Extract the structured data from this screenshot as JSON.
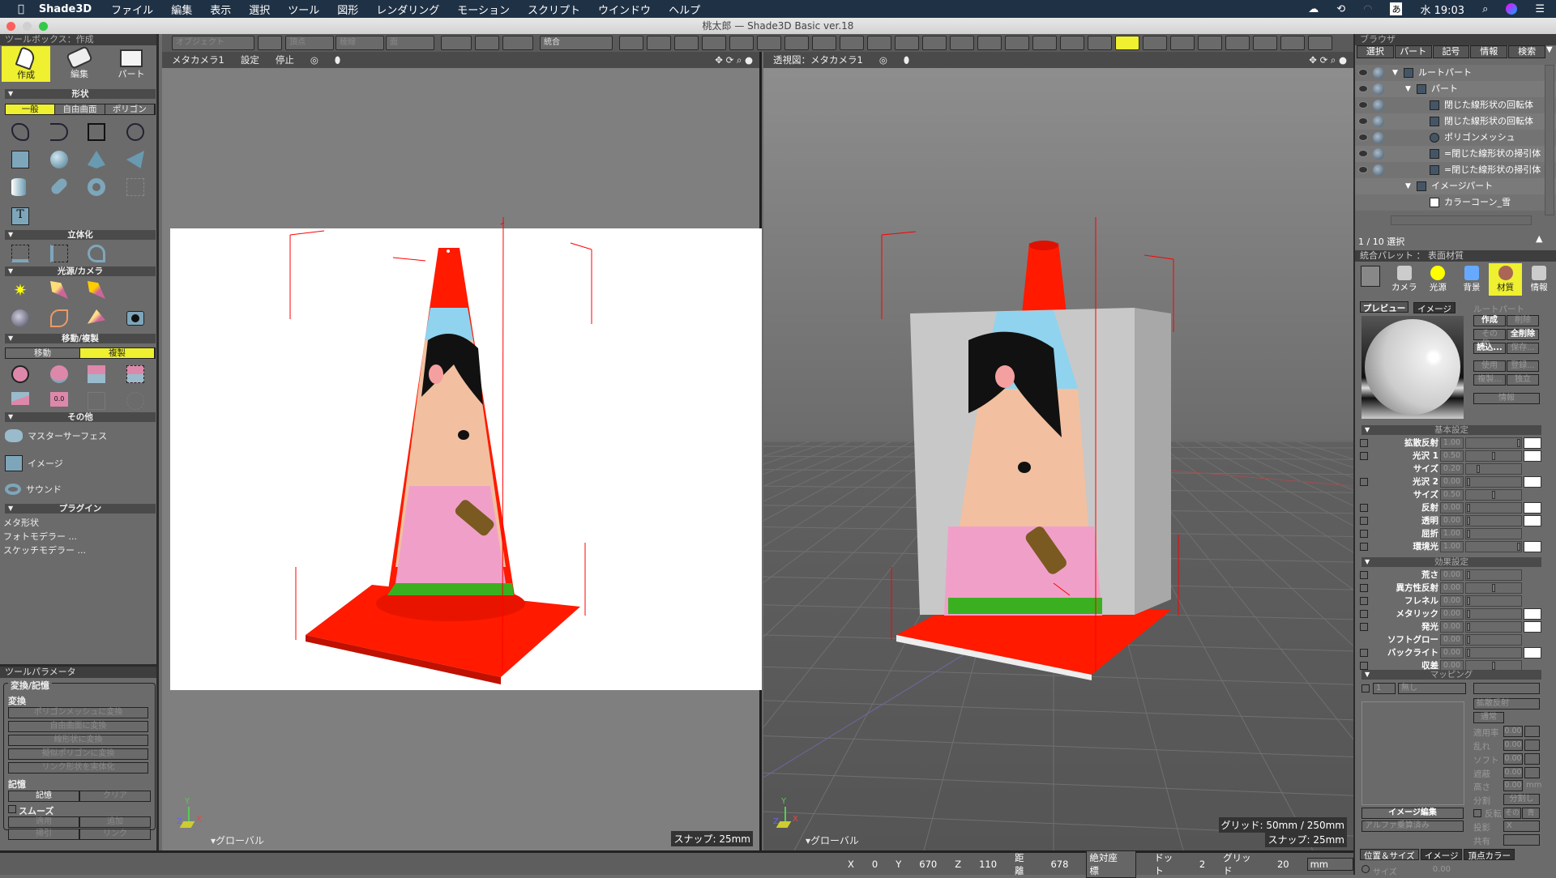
{
  "menubar": {
    "app": "Shade3D",
    "items": [
      "ファイル",
      "編集",
      "表示",
      "選択",
      "ツール",
      "図形",
      "レンダリング",
      "モーション",
      "スクリプト",
      "ウインドウ",
      "ヘルプ"
    ],
    "ime": "あ",
    "clock": "水 19:03"
  },
  "window": {
    "title": "桃太郎 — Shade3D Basic ver.18"
  },
  "toolbox": {
    "header": "ツールボックス：作成",
    "modes": [
      "作成",
      "編集",
      "パート"
    ],
    "active_mode": "作成",
    "shape_header": "形状",
    "shape_tabs": [
      "一般",
      "自由曲面",
      "ポリゴン"
    ],
    "active_shape_tab": "一般",
    "solid_header": "立体化",
    "light_header": "光源/カメラ",
    "move_header": "移動/複製",
    "move_tabs": [
      "移動",
      "複製"
    ],
    "active_move_tab": "複製",
    "other_header": "その他",
    "other_items": [
      "マスターサーフェス",
      "イメージ",
      "サウンド"
    ],
    "plugin_header": "プラグイン",
    "plugins": [
      "メタ形状",
      "フォトモデラー ...",
      "スケッチモデラー ..."
    ]
  },
  "toolparam": {
    "header": "ツールパラメータ",
    "group": "変換/記憶",
    "convert_label": "変換",
    "convert_buttons": [
      "ポリゴンメッシュに変換",
      "自由曲面に変換",
      "線形状に変換",
      "擬似ポリゴンに変換",
      "リンク形状を実体化"
    ],
    "memory_label": "記憶",
    "memory_buttons": [
      "記憶",
      "クリア"
    ],
    "smooth_label": "スムーズ",
    "smooth_checked": false,
    "bottom_buttons": [
      "適用",
      "追加",
      "掃引",
      "リンク"
    ]
  },
  "toolbar": {
    "object": "オブジェクト",
    "vertex": "頂点",
    "edge": "稜線",
    "face": "面",
    "unified": "統合"
  },
  "viewport_left": {
    "camera": "メタカメラ1",
    "settings": "設定",
    "stop": "停止",
    "coord": "グローバル",
    "snap": "スナップ: 25mm"
  },
  "viewport_right": {
    "camera": "透視図：メタカメラ1",
    "coord": "グローバル",
    "grid": "グリッド: 50mm / 250mm",
    "snap": "スナップ: 25mm"
  },
  "browser": {
    "header": "ブラウザ",
    "tabs": [
      "選択",
      "パート",
      "記号",
      "情報",
      "検索"
    ],
    "tree": [
      {
        "label": "ルートパート",
        "depth": 0,
        "icon": "part-folder"
      },
      {
        "label": "パート",
        "depth": 1,
        "icon": "part-folder"
      },
      {
        "label": "閉じた線形状の回転体",
        "depth": 2,
        "icon": "revolve"
      },
      {
        "label": "閉じた線形状の回転体",
        "depth": 2,
        "icon": "revolve"
      },
      {
        "label": "ポリゴンメッシュ",
        "depth": 2,
        "icon": "polygon-mesh"
      },
      {
        "label": "=閉じた線形状の掃引体",
        "depth": 2,
        "icon": "sweep"
      },
      {
        "label": "=閉じた線形状の掃引体",
        "depth": 2,
        "icon": "sweep"
      },
      {
        "label": "イメージパート",
        "depth": 1,
        "icon": "image-folder"
      },
      {
        "label": "カラーコーン_雪",
        "depth": 2,
        "icon": "image"
      }
    ],
    "selection": "1 / 10 選択"
  },
  "palette": {
    "header": "統合パレット ： 表面材質",
    "tabs": [
      "カメラ",
      "光源",
      "背景",
      "材質",
      "情報"
    ],
    "active_tab": "材質",
    "preview_tabs": [
      "プレビュー",
      "イメージ"
    ],
    "target": "ルートパート",
    "buttons": [
      [
        "作成",
        "削除"
      ],
      [
        "その他...",
        "全削除"
      ],
      [
        "読込...",
        "保存..."
      ],
      [
        "使用",
        "登録..."
      ],
      [
        "複製...",
        "独立"
      ]
    ],
    "info_button": "情報",
    "basic_header": "基本設定",
    "basic": [
      {
        "label": "拡散反射",
        "value": "1.00",
        "slider": 1.0,
        "checkbox": true,
        "swatch": "#ffffff"
      },
      {
        "label": "光沢 1",
        "value": "0.50",
        "slider": 0.5,
        "checkbox": true,
        "swatch": "#ffffff"
      },
      {
        "label": "サイズ",
        "value": "0.20",
        "slider": 0.2,
        "checkbox": false
      },
      {
        "label": "光沢 2",
        "value": "0.00",
        "slider": 0,
        "checkbox": true,
        "swatch": "#ffffff"
      },
      {
        "label": "サイズ",
        "value": "0.50",
        "slider": 0.5,
        "checkbox": false
      },
      {
        "label": "反射",
        "value": "0.00",
        "slider": 0,
        "checkbox": true,
        "swatch": "#ffffff"
      },
      {
        "label": "透明",
        "value": "0.00",
        "slider": 0,
        "checkbox": true,
        "swatch": "#ffffff"
      },
      {
        "label": "屈折",
        "value": "1.00",
        "slider": 0,
        "checkbox": true
      },
      {
        "label": "環境光",
        "value": "1.00",
        "slider": 1.0,
        "checkbox": true,
        "swatch": "#ffffff"
      }
    ],
    "effect_header": "効果設定",
    "effect": [
      {
        "label": "荒さ",
        "value": "0.00",
        "slider": 0,
        "checkbox": true
      },
      {
        "label": "異方性反射",
        "value": "0.00",
        "slider": 0.5,
        "checkbox": true
      },
      {
        "label": "フレネル",
        "value": "0.00",
        "slider": 0,
        "checkbox": true
      },
      {
        "label": "メタリック",
        "value": "0.00",
        "slider": 0,
        "checkbox": true,
        "swatch": "#ffffff"
      },
      {
        "label": "発光",
        "value": "0.00",
        "slider": 0,
        "checkbox": true,
        "swatch": "#ffffff"
      },
      {
        "label": "ソフトグロー",
        "value": "0.00",
        "slider": 0,
        "checkbox": false
      },
      {
        "label": "バックライト",
        "value": "0.00",
        "slider": 0,
        "checkbox": true,
        "swatch": "#ffffff"
      },
      {
        "label": "収差",
        "value": "0.00",
        "slider": 0.5,
        "checkbox": true
      }
    ],
    "mapping_header": "マッピング",
    "mapping": {
      "layer": "1",
      "type": "無し",
      "channel": "拡散反射",
      "blend": "通常",
      "params": [
        {
          "label": "適用率",
          "value": "0.00"
        },
        {
          "label": "乱れ",
          "value": "0.00"
        },
        {
          "label": "ソフト",
          "value": "0.00"
        },
        {
          "label": "遮蔽",
          "value": "0.00"
        }
      ],
      "height_label": "高さ",
      "height_value": "0.00",
      "height_unit": "mm",
      "split_label": "分割",
      "split_value": "分割し",
      "flip_label": "反転",
      "flip_a": "その",
      "flip_b": "青",
      "projection_label": "投影",
      "projection": "X",
      "share_label": "共有",
      "image_edit": "イメージ編集",
      "alpha": "アルファ乗算済み"
    },
    "bottom_tabs": [
      "位置＆サイズ",
      "イメージ",
      "頂点カラー"
    ],
    "size_label": "サイズ",
    "size_value": "0.00"
  },
  "status": {
    "x_label": "X",
    "x": "0",
    "y_label": "Y",
    "y": "670",
    "z_label": "Z",
    "z": "110",
    "dist_label": "距離",
    "dist": "678",
    "coord_mode": "絶対座標",
    "dot_label": "ドット",
    "dot": "2",
    "grid_label": "グリッド",
    "grid": "20",
    "unit": "mm"
  },
  "colors": {
    "accent": "#eef030",
    "menubar": "#1f3145",
    "cone_red": "#ff1a00"
  }
}
